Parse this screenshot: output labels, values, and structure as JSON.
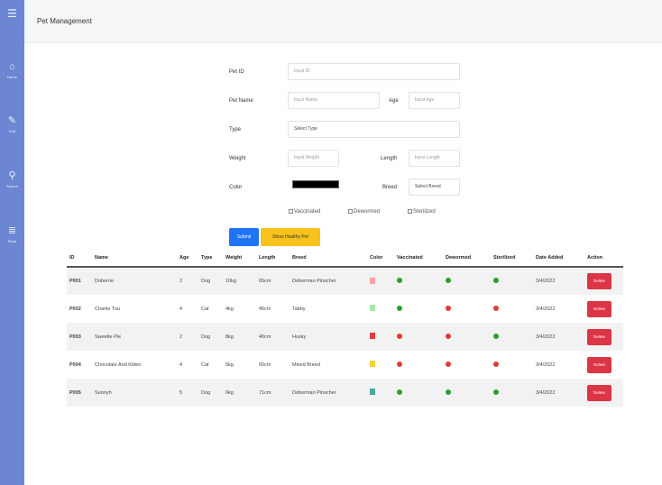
{
  "sidebar": {
    "menu_icon": "☰",
    "items": [
      {
        "icon": "⌂",
        "label": "Home",
        "icon_name": "home-icon"
      },
      {
        "icon": "✎",
        "label": "Edit",
        "icon_name": "edit-icon"
      },
      {
        "icon": "⚲",
        "label": "Search",
        "icon_name": "search-icon"
      },
      {
        "icon": "≣",
        "label": "Read",
        "icon_name": "list-icon"
      }
    ]
  },
  "header": {
    "title": "Pet Management"
  },
  "form": {
    "pet_id_label": "Pet ID",
    "pet_id_placeholder": "Input ID",
    "pet_name_label": "Pet Name",
    "pet_name_placeholder": "Input Name",
    "age_label": "Age",
    "age_placeholder": "Input Age",
    "type_label": "Type",
    "type_value": "Select Type",
    "weight_label": "Weight",
    "weight_placeholder": "Input Weight",
    "length_label": "Length",
    "length_placeholder": "Input Length",
    "color_label": "Color",
    "color_value": "#000000",
    "breed_label": "Breed",
    "breed_value": "Select Breed",
    "vaccinated_label": "Vaccinated",
    "dewormed_label": "Dewormed",
    "sterilized_label": "Sterilized",
    "submit_label": "Submit",
    "show_label": "Show Healthy Pet"
  },
  "table": {
    "headers": [
      "ID",
      "Name",
      "Age",
      "Type",
      "Weight",
      "Length",
      "Breed",
      "Color",
      "Vaccinated",
      "Dewormed",
      "Sterilized",
      "Date Added",
      "Action"
    ],
    "delete_label": "Delete",
    "rows": [
      {
        "id": "P001",
        "name": "Doberrie",
        "age": "2",
        "type": "Dog",
        "weight": "10kg",
        "length": "65cm",
        "breed": "Doberman Pinscher",
        "color": "#f4a3a3",
        "vaccinated": "#2ca02c",
        "dewormed": "#2ca02c",
        "sterilized": "#2ca02c",
        "date": "3/4/2022"
      },
      {
        "id": "P002",
        "name": "Charlie Tuu",
        "age": "4",
        "type": "Cat",
        "weight": "4kg",
        "length": "45cm",
        "breed": "Tabby",
        "color": "#a8e6a8",
        "vaccinated": "#2ca02c",
        "dewormed": "#e53935",
        "sterilized": "#e53935",
        "date": "3/4/2022"
      },
      {
        "id": "P003",
        "name": "Sweetie Pie",
        "age": "2",
        "type": "Dog",
        "weight": "8kg",
        "length": "40cm",
        "breed": "Husky",
        "color": "#e53935",
        "vaccinated": "#e53935",
        "dewormed": "#e53935",
        "sterilized": "#2ca02c",
        "date": "3/4/2022"
      },
      {
        "id": "P004",
        "name": "Chocolate And Kitten",
        "age": "4",
        "type": "Cat",
        "weight": "5kg",
        "length": "65cm",
        "breed": "Mixed Breed",
        "color": "#f2d331",
        "vaccinated": "#e53935",
        "dewormed": "#e53935",
        "sterilized": "#e53935",
        "date": "3/4/2022"
      },
      {
        "id": "P005",
        "name": "Sunnyh",
        "age": "5",
        "type": "Dog",
        "weight": "6kg",
        "length": "71cm",
        "breed": "Doberman Pinscher",
        "color": "#4aa8a0",
        "vaccinated": "#2ca02c",
        "dewormed": "#2ca02c",
        "sterilized": "#2ca02c",
        "date": "3/4/2022"
      }
    ]
  }
}
